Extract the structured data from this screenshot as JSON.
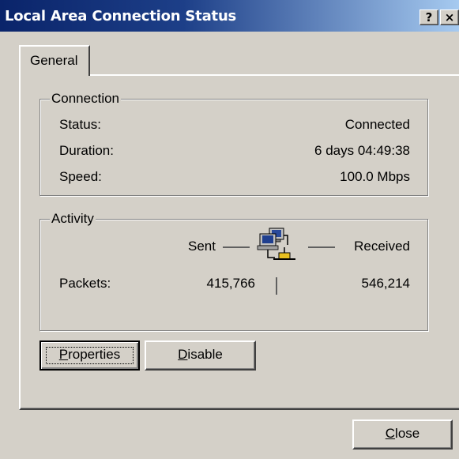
{
  "window": {
    "title": "Local Area Connection Status",
    "help_glyph": "?",
    "close_glyph": "×"
  },
  "tabs": [
    {
      "label": "General",
      "selected": true
    }
  ],
  "connection": {
    "legend": "Connection",
    "rows": [
      {
        "label": "Status:",
        "value": "Connected"
      },
      {
        "label": "Duration:",
        "value": "6 days 04:49:38"
      },
      {
        "label": "Speed:",
        "value": "100.0 Mbps"
      }
    ]
  },
  "activity": {
    "legend": "Activity",
    "sent_label": "Sent",
    "received_label": "Received",
    "packets_label": "Packets:",
    "packets_sent": "415,766",
    "packets_received": "546,214",
    "icon": "network-computers-icon"
  },
  "buttons": {
    "properties": {
      "mnemonic": "P",
      "rest": "roperties"
    },
    "disable": {
      "mnemonic": "D",
      "rest": "isable"
    },
    "close": {
      "mnemonic": "C",
      "rest": "lose"
    }
  },
  "colors": {
    "titlebar_start": "#0a246a",
    "titlebar_end": "#a6caf0",
    "face": "#d4d0c8"
  }
}
